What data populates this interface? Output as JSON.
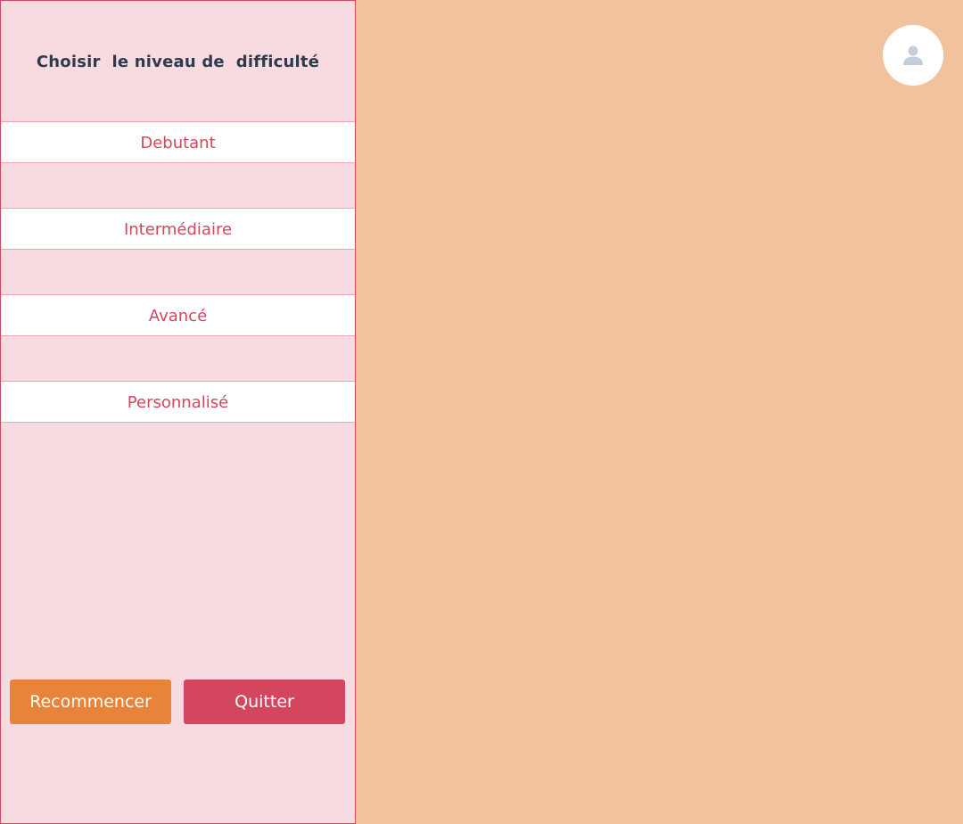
{
  "sidebar": {
    "title": "Choisir  le niveau de  difficulté",
    "levels": [
      {
        "label": "Debutant"
      },
      {
        "label": "Intermédiaire"
      },
      {
        "label": "Avancé"
      },
      {
        "label": "Personnalisé"
      }
    ],
    "buttons": {
      "restart_label": "Recommencer",
      "quit_label": "Quitter"
    }
  },
  "header": {
    "avatar_icon": "user-icon"
  },
  "colors": {
    "page_background": "#f2c19e",
    "sidebar_background": "#f7dbe0",
    "accent": "#d3465e",
    "restart_button": "#e8843a",
    "title_text": "#2e3b4e"
  }
}
